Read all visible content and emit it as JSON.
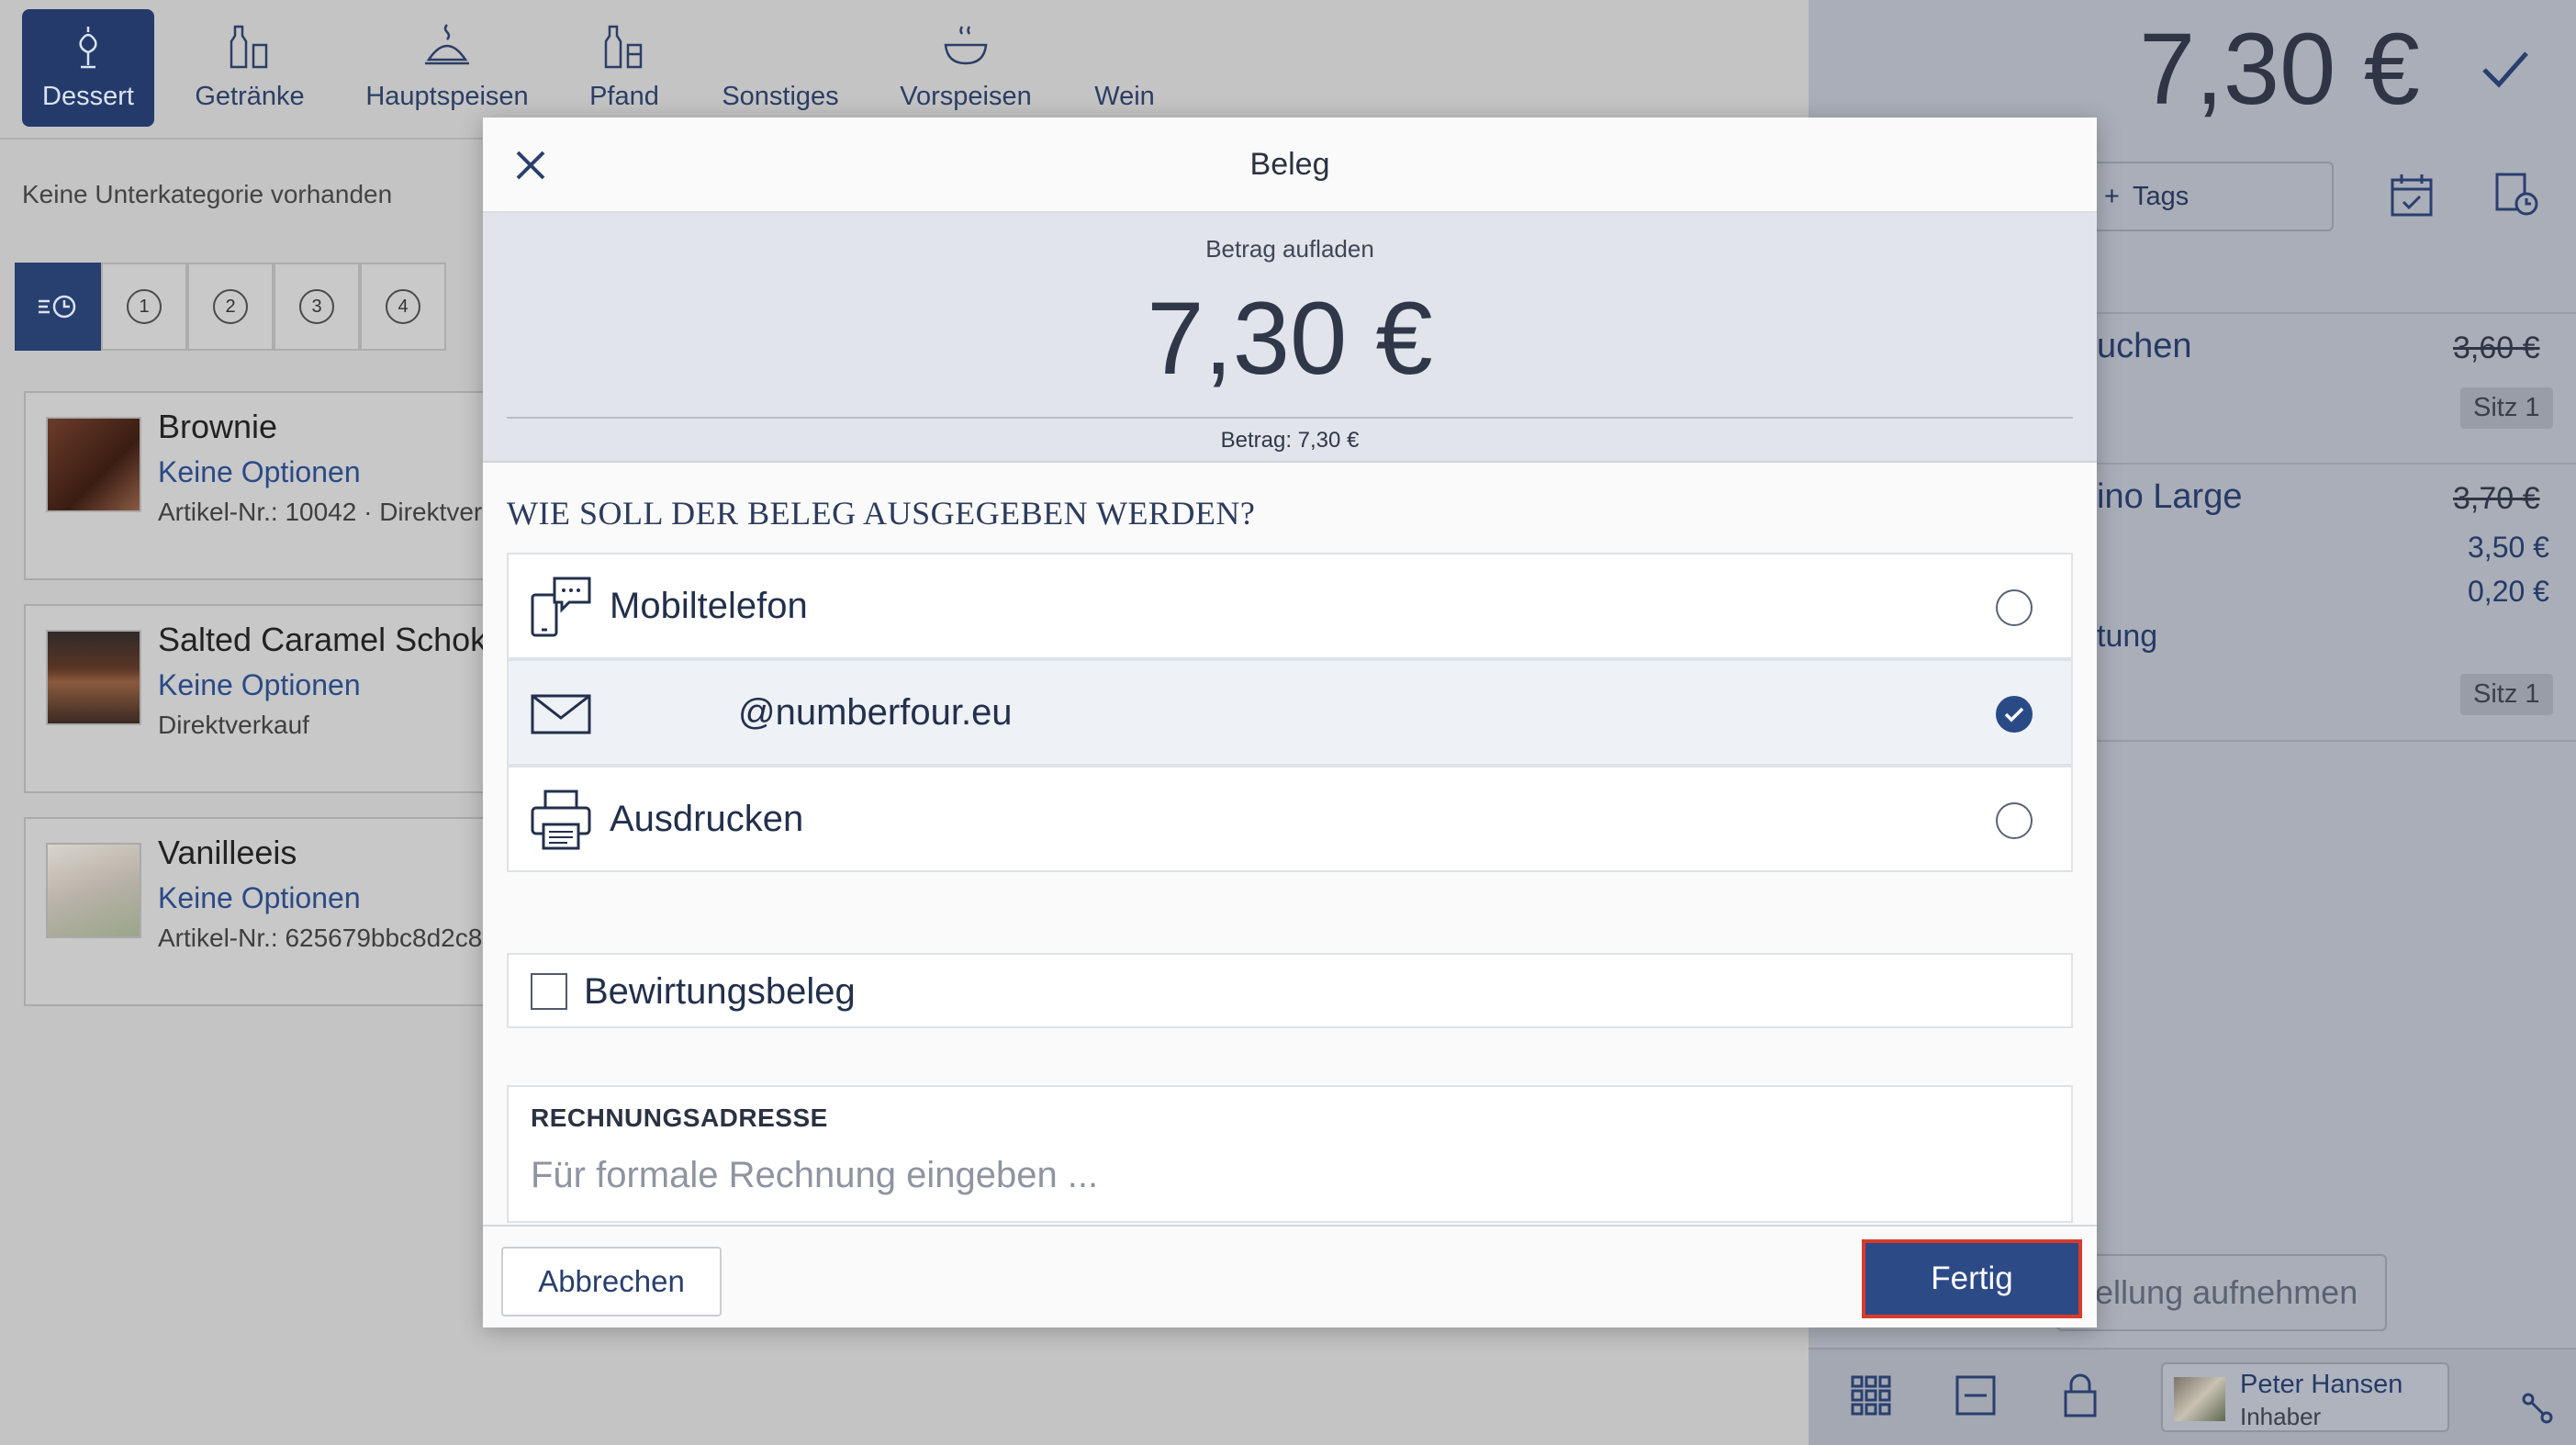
{
  "categories": [
    {
      "label": "Dessert",
      "icon": "dessert-icon",
      "active": true
    },
    {
      "label": "Getränke",
      "icon": "drinks-icon"
    },
    {
      "label": "Hauptspeisen",
      "icon": "main-dish-icon"
    },
    {
      "label": "Pfand",
      "icon": "deposit-icon"
    },
    {
      "label": "Sonstiges",
      "icon": "other-icon"
    },
    {
      "label": "Vorspeisen",
      "icon": "starter-icon"
    },
    {
      "label": "Wein",
      "icon": "wine-icon"
    }
  ],
  "subcategory_text": "Keine Unterkategorie vorhanden",
  "filters": [
    "1",
    "2",
    "3",
    "4"
  ],
  "products": [
    {
      "name": "Brownie",
      "options": "Keine Optionen",
      "article": "Artikel-Nr.: 10042 · Direktver"
    },
    {
      "name": "Salted Caramel Schoko",
      "options": "Keine Optionen",
      "article": "Direktverkauf"
    },
    {
      "name": "Vanilleeis",
      "options": "Keine Optionen",
      "article": "Artikel-Nr.: 625679bbc8d2c8"
    }
  ],
  "right_panel": {
    "total": "7,30 €",
    "tags_label": "Tags",
    "item1_name": "uchen",
    "item1_price": "3,60 €",
    "item1_seat": "Sitz 1",
    "item2_name": "ino Large",
    "item2_price_old": "3,70 €",
    "item2_price1": "3,50 €",
    "item2_price2": "0,20 €",
    "item2_note": "tung",
    "item2_seat": "Sitz 1",
    "order_button": "tellung aufnehmen",
    "user_name": "Peter Hansen",
    "user_role": "Inhaber"
  },
  "modal": {
    "title": "Beleg",
    "amount_label": "Betrag aufladen",
    "amount_value": "7,30 €",
    "amount_sub": "Betrag: 7,30 €",
    "question": "WIE SOLL DER BELEG AUSGEGEBEN WERDEN?",
    "options": [
      {
        "label": "Mobiltelefon",
        "icon": "mobile-chat-icon",
        "selected": false
      },
      {
        "label": "@numberfour.eu",
        "icon": "mail-icon",
        "selected": true
      },
      {
        "label": "Ausdrucken",
        "icon": "printer-icon",
        "selected": false
      }
    ],
    "bewirtung_label": "Bewirtungsbeleg",
    "address_label": "RECHNUNGSADRESSE",
    "address_placeholder": "Für formale Rechnung eingeben ...",
    "address_value": "",
    "cancel_label": "Abbrechen",
    "done_label": "Fertig"
  }
}
